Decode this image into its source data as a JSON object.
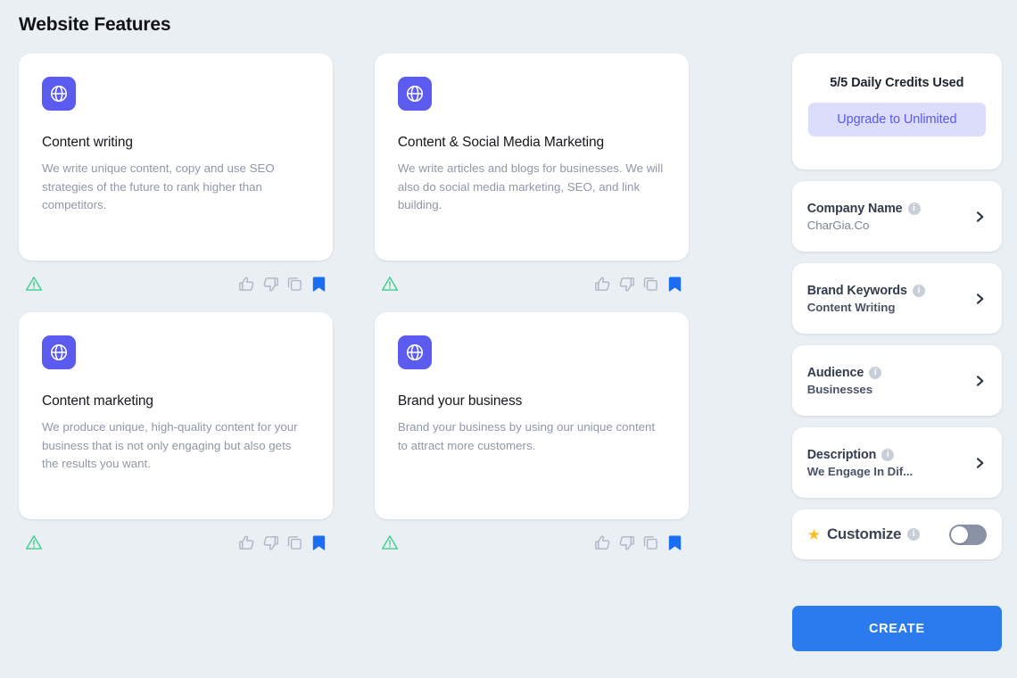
{
  "page": {
    "title": "Website Features"
  },
  "features": [
    {
      "icon": "globe-icon",
      "title": "Content writing",
      "description": "We write unique content, copy and use SEO strategies of the future to rank higher than competitors."
    },
    {
      "icon": "globe-icon",
      "title": "Content & Social Media Marketing",
      "description": "We write articles and blogs for businesses. We will also do social media marketing, SEO, and link building."
    },
    {
      "icon": "globe-icon",
      "title": "Content marketing",
      "description": "We produce unique, high-quality content for your business that is not only engaging but also gets the results you want."
    },
    {
      "icon": "globe-icon",
      "title": "Brand your business",
      "description": "Brand your business by using our unique content to attract more customers."
    }
  ],
  "card_actions": {
    "warning_icon": "warning-triangle-icon",
    "thumbs_up_icon": "thumbs-up-icon",
    "thumbs_down_icon": "thumbs-down-icon",
    "copy_icon": "copy-icon",
    "bookmark_icon": "bookmark-icon"
  },
  "sidebar": {
    "credits": {
      "text": "5/5 Daily Credits Used",
      "upgrade_label": "Upgrade to Unlimited"
    },
    "fields": [
      {
        "label": "Company Name",
        "value": "CharGia.Co",
        "value_style": "light",
        "info_icon": "info-icon",
        "chevron_icon": "chevron-right-icon"
      },
      {
        "label": "Brand Keywords",
        "value": "Content Writing",
        "value_style": "bold",
        "info_icon": "info-icon",
        "chevron_icon": "chevron-right-icon"
      },
      {
        "label": "Audience",
        "value": "Businesses",
        "value_style": "bold",
        "info_icon": "info-icon",
        "chevron_icon": "chevron-right-icon"
      },
      {
        "label": "Description",
        "value": "We Engage In Dif...",
        "value_style": "bold",
        "info_icon": "info-icon",
        "chevron_icon": "chevron-right-icon"
      }
    ],
    "customize": {
      "label": "Customize",
      "star_icon": "star-icon",
      "info_icon": "info-icon",
      "toggle_state": "off"
    },
    "create_label": "CREATE"
  },
  "colors": {
    "background": "#eaeff4",
    "card": "#ffffff",
    "accent_indigo": "#5b5bef",
    "upgrade_bg": "#dcdcfb",
    "upgrade_text": "#5a5af0",
    "create_blue": "#2a7bed",
    "bookmark_blue": "#1b6ef3",
    "warning_green": "#3ecf8e",
    "star_yellow": "#fbbf24",
    "toggle_off": "#8a93a6"
  }
}
